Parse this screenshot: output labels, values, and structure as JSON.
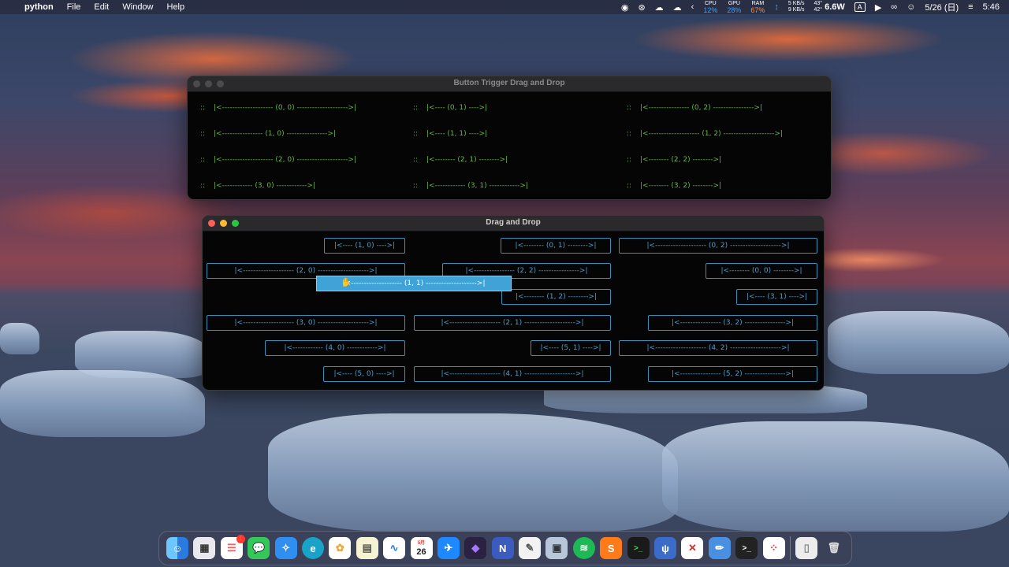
{
  "menubar": {
    "apple": "",
    "app_name": "python",
    "menus": [
      "File",
      "Edit",
      "Window",
      "Help"
    ],
    "cpu_label": "CPU",
    "cpu_value": "12%",
    "gpu_label": "GPU",
    "gpu_value": "28%",
    "ram_label": "RAM",
    "ram_value": "67%",
    "net_up": "5 KB/s",
    "net_down": "9 KB/s",
    "temp_top": "43°",
    "temp_bottom": "42°",
    "power": "6.6W",
    "input_source": "A",
    "date": "5/26 (日)",
    "time": "5:46",
    "accent_cpu": "#3aa0ff",
    "accent_ram": "#ff8a3a"
  },
  "window_trigger": {
    "title": "Button Trigger Drag and Drop",
    "grip": "::",
    "rows": [
      [
        "|<-------------------- (0, 0) -------------------->|",
        "|<---- (0, 1) ---->|",
        "|<---------------- (0, 2) ---------------->|"
      ],
      [
        "|<---------------- (1, 0) ---------------->|",
        "|<---- (1, 1) ---->|",
        "|<-------------------- (1, 2) -------------------->|"
      ],
      [
        "|<-------------------- (2, 0) -------------------->|",
        "|<-------- (2, 1) -------->|",
        "|<-------- (2, 2) -------->|"
      ],
      [
        "|<------------ (3, 0) ------------>|",
        "|<------------ (3, 1) ------------>|",
        "|<-------- (3, 2) -------->|"
      ]
    ]
  },
  "window_dnd": {
    "title": "Drag and Drop",
    "buttons": [
      "|<---- (1, 0) ---->|",
      "|<-------- (0, 1) -------->|",
      "|<-------------------- (0, 2) -------------------->|",
      "|<-------------------- (2, 0) -------------------->|",
      "|<---------------- (2, 2) ---------------->|",
      "|<-------- (0, 0) -------->|",
      "|<-------- (1, 2) -------->|",
      "|<---- (3, 1) ---->|",
      "|<-------------------- (3, 0) -------------------->|",
      "|<-------------------- (2, 1) -------------------->|",
      "|<---------------- (3, 2) ---------------->|",
      "|<------------ (4, 0) ------------>|",
      "|<---- (5, 1) ---->|",
      "|<-------------------- (4, 2) -------------------->|",
      "|<---- (5, 0) ---->|",
      "|<-------------------- (4, 1) -------------------->|",
      "|<---------------- (5, 2) ---------------->|"
    ],
    "dragging": "|<-------------------- (1, 1) -------------------->|"
  },
  "dock": {
    "calendar_month": "5月",
    "calendar_day": "26",
    "reminders_badge": "1",
    "notion_letter": "N",
    "terminal_prompt": ">_",
    "items": [
      "finder-icon",
      "launchpad-icon",
      "reminders-icon",
      "messages-icon",
      "safari-icon",
      "edge-icon",
      "photos-icon",
      "notes-icon",
      "freeform-icon",
      "calendar-icon",
      "testflight-icon",
      "obsidian-icon",
      "notion-icon",
      "textedit-icon",
      "preview-icon",
      "spotify-icon",
      "sublime-icon",
      "terminal-icon",
      "fork-icon",
      "xcode-icon",
      "pencil-icon",
      "terminal2-icon",
      "palette-icon",
      "downloads-icon",
      "trash-icon"
    ]
  }
}
